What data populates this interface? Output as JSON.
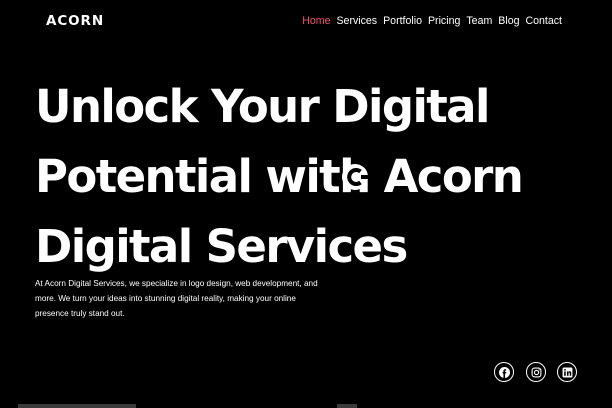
{
  "brand": {
    "logo": "ACORN"
  },
  "nav": {
    "items": [
      {
        "label": "Home",
        "active": true
      },
      {
        "label": "Services"
      },
      {
        "label": "Portfolio"
      },
      {
        "label": "Pricing"
      },
      {
        "label": "Team"
      },
      {
        "label": "Blog"
      },
      {
        "label": "Contact"
      }
    ],
    "active_color": "#f0506e"
  },
  "hero": {
    "title_lines": [
      "Unlock Your Digital",
      "Potential with Acorn",
      "Digital Services"
    ],
    "description": "At Acorn Digital Services, we specialize in logo design, web development, and more. We turn your ideas into stunning digital reality, making your online presence truly stand out."
  },
  "social": [
    {
      "icon": "facebook-icon"
    },
    {
      "icon": "instagram-icon"
    },
    {
      "icon": "linkedin-icon"
    }
  ],
  "colors": {
    "background": "#000000",
    "text": "#ffffff",
    "accent": "#f0506e"
  }
}
